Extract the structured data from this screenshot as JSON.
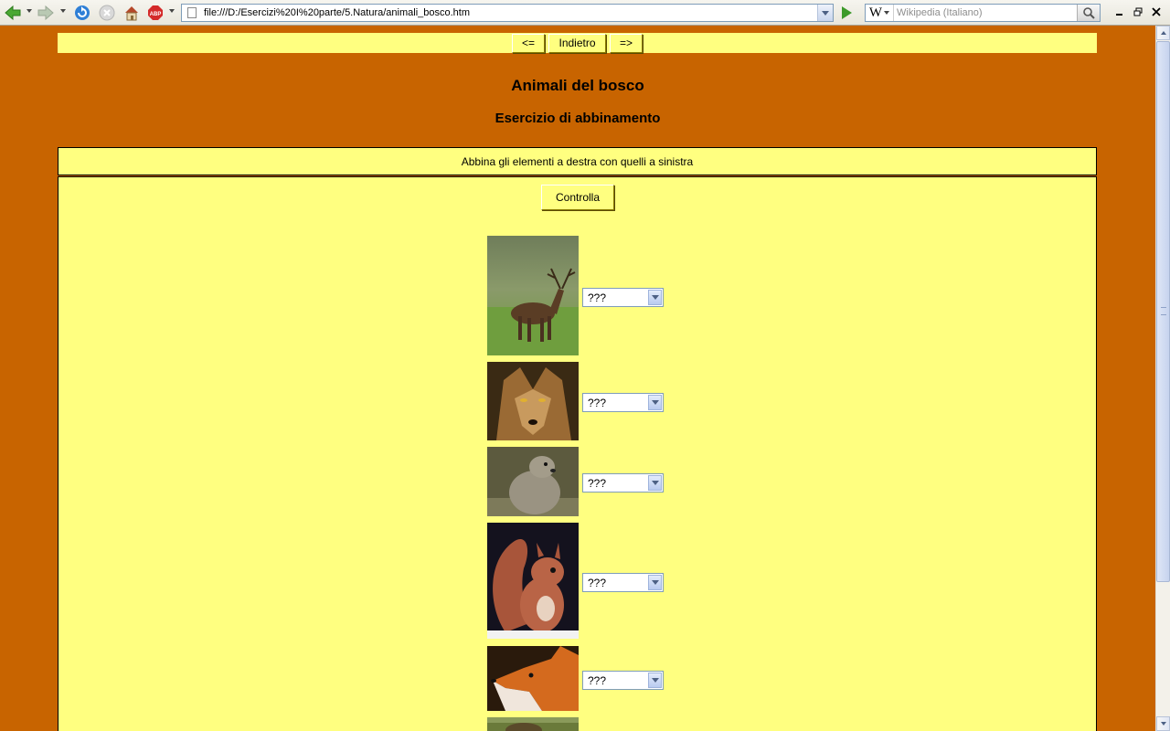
{
  "browser": {
    "url": "file:///D:/Esercizi%20I%20parte/5.Natura/animali_bosco.htm",
    "search_engine": "W",
    "search_placeholder": "Wikipedia (Italiano)",
    "adblock_label": "ABP"
  },
  "nav": {
    "prev_label": "<=",
    "back_label": "Indietro",
    "next_label": "=>"
  },
  "page": {
    "title": "Animali del bosco",
    "subtitle": "Esercizio di abbinamento",
    "instructions": "Abbina gli elementi a destra con quelli a sinistra",
    "check_label": "Controlla"
  },
  "matches": [
    {
      "animal": "cervo",
      "selected": "???"
    },
    {
      "animal": "lupo",
      "selected": "???"
    },
    {
      "animal": "marmotta",
      "selected": "???"
    },
    {
      "animal": "scoiattolo",
      "selected": "???"
    },
    {
      "animal": "volpe",
      "selected": "???"
    }
  ],
  "colors": {
    "page_background": "#c86400",
    "panel_background": "#ffff80"
  }
}
